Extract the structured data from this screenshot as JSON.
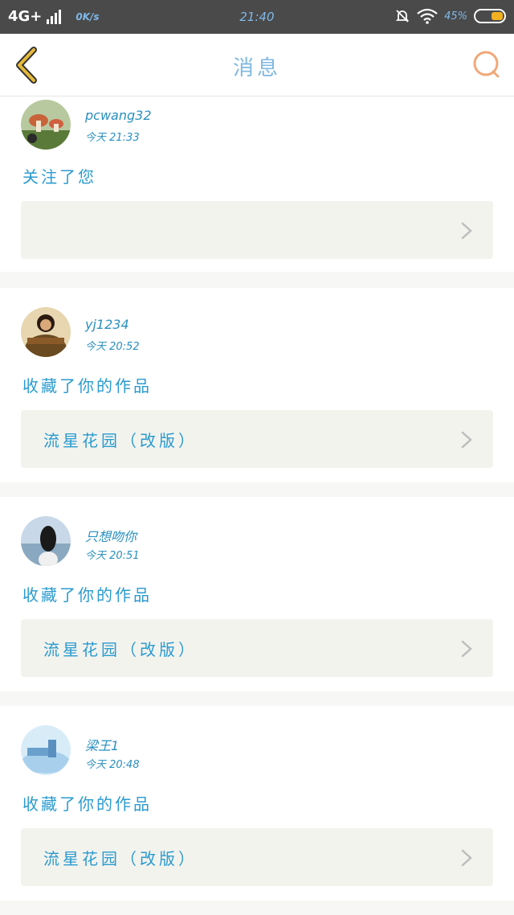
{
  "status_bar": {
    "network": "4G+",
    "speed": "0K/s",
    "time": "21:40",
    "battery": "45%"
  },
  "header": {
    "title": "消息"
  },
  "messages": [
    {
      "username": "pcwang32",
      "time": "今天 21:33",
      "action": "关注了您",
      "work": ""
    },
    {
      "username": "yj1234",
      "time": "今天 20:52",
      "action": "收藏了你的作品",
      "work": "流星花园（改版）"
    },
    {
      "username": "只想吻你",
      "time": "今天 20:51",
      "action": "收藏了你的作品",
      "work": "流星花园（改版）"
    },
    {
      "username": "梁王1",
      "time": "今天 20:48",
      "action": "收藏了你的作品",
      "work": "流星花园（改版）"
    }
  ],
  "colors": {
    "accent_blue": "#2a9bd0",
    "title_blue": "#7fb8e0",
    "back_arrow": "#e6b93a",
    "search_icon": "#f0a878",
    "status_bar_bg": "#4a4a4a"
  }
}
